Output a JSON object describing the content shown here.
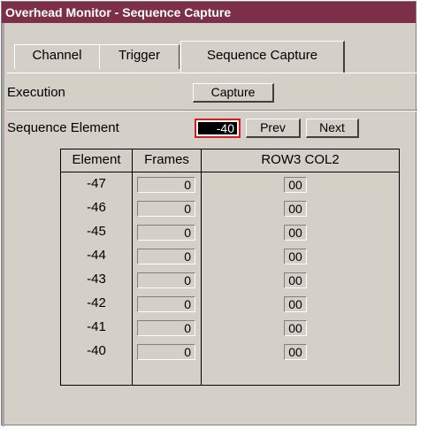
{
  "window": {
    "title": "Overhead Monitor - Sequence Capture"
  },
  "tabs": [
    {
      "label": "Channel"
    },
    {
      "label": "Trigger"
    },
    {
      "label": "Sequence Capture"
    }
  ],
  "execution": {
    "label": "Execution",
    "capture_label": "Capture"
  },
  "sequence": {
    "label": "Sequence Element",
    "value": "-40",
    "prev_label": "Prev",
    "next_label": "Next"
  },
  "table": {
    "headers": [
      "Element",
      "Frames",
      "ROW3 COL2"
    ],
    "rows": [
      {
        "element": "-47",
        "frames": "0",
        "value": "00"
      },
      {
        "element": "-46",
        "frames": "0",
        "value": "00"
      },
      {
        "element": "-45",
        "frames": "0",
        "value": "00"
      },
      {
        "element": "-44",
        "frames": "0",
        "value": "00"
      },
      {
        "element": "-43",
        "frames": "0",
        "value": "00"
      },
      {
        "element": "-42",
        "frames": "0",
        "value": "00"
      },
      {
        "element": "-41",
        "frames": "0",
        "value": "00"
      },
      {
        "element": "-40",
        "frames": "0",
        "value": "00"
      }
    ]
  },
  "colors": {
    "titlebar": "#7d2e48",
    "panel": "#d4d0c8",
    "focus_border": "#d02020"
  }
}
